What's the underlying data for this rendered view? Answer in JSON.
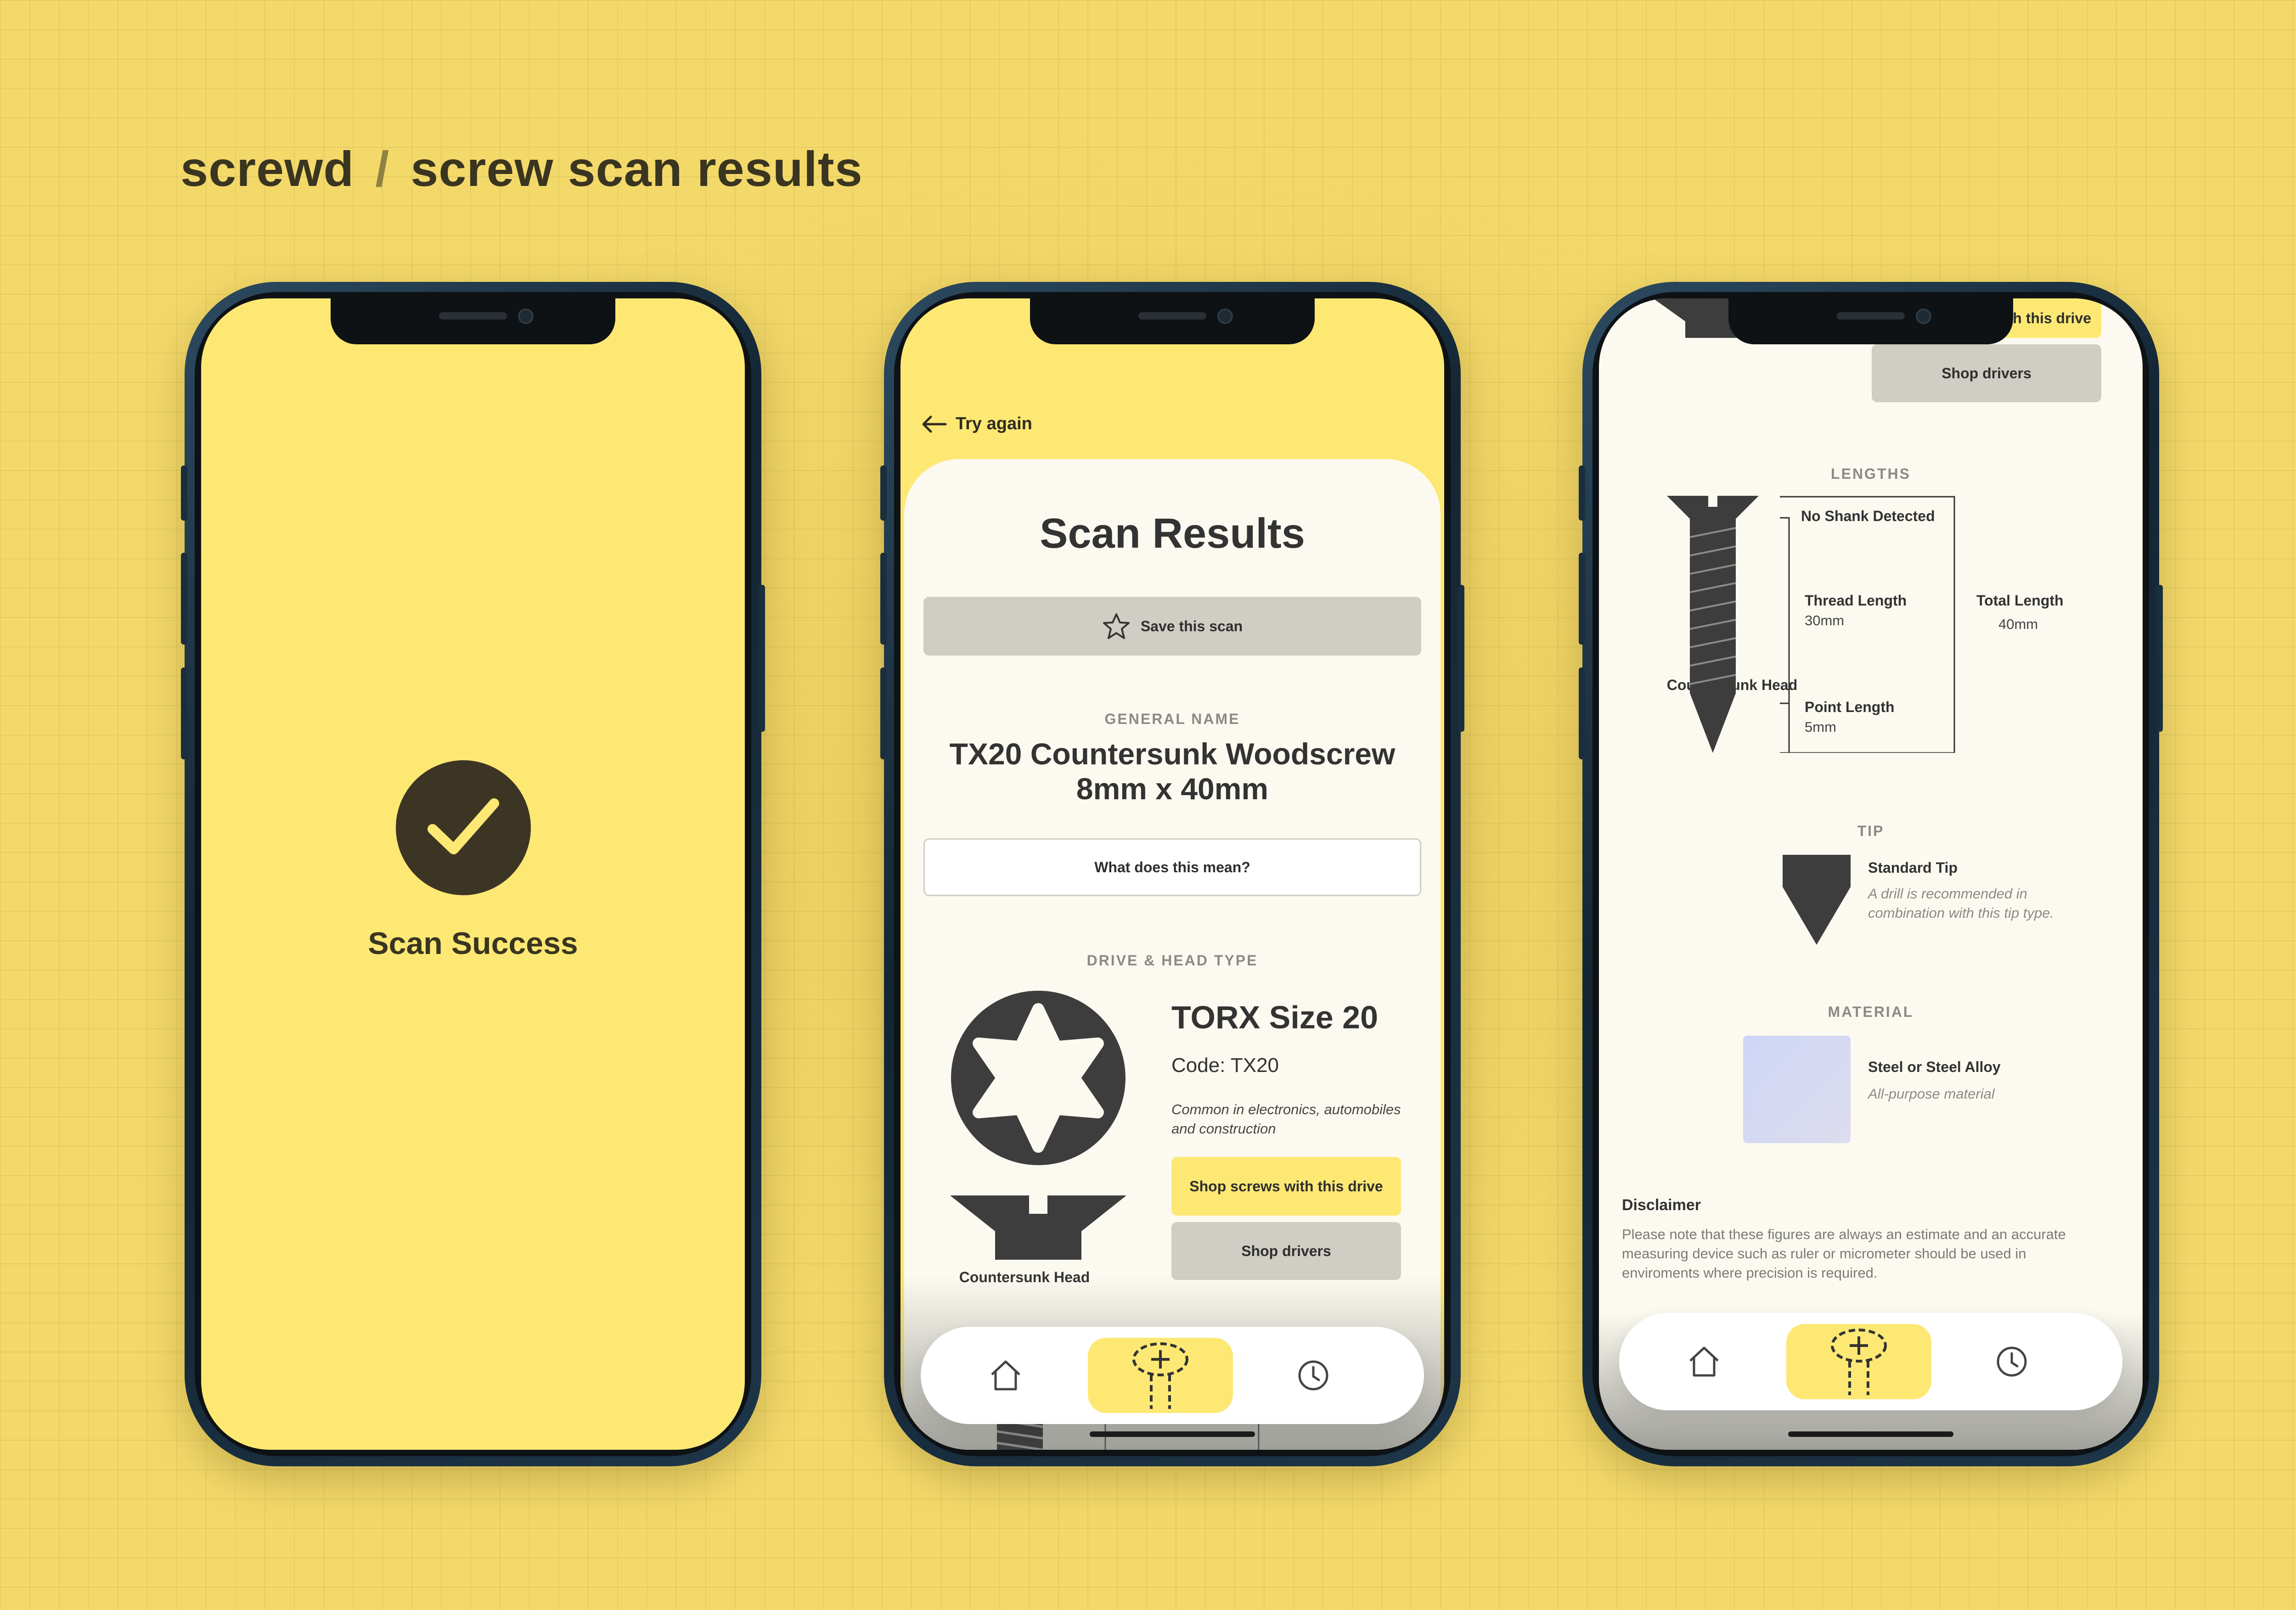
{
  "header": {
    "brand": "screwd",
    "separator": "/",
    "title": "screw scan results"
  },
  "phone1": {
    "status": "Scan Success"
  },
  "phone2": {
    "back_label": "Try again",
    "heading": "Scan Results",
    "save_label": "Save this scan",
    "general_name_label": "GENERAL NAME",
    "general_name": "TX20 Countersunk Woodscrew 8mm x 40mm",
    "what_mean_label": "What does this mean?",
    "drive_head_label": "DRIVE & HEAD TYPE",
    "drive_title": "TORX Size 20",
    "drive_code": "Code: TX20",
    "drive_desc": "Common in electronics, automobiles and construction",
    "shop_screws_label": "Shop screws with this drive",
    "shop_drivers_label": "Shop drivers",
    "head_label": "Countersunk Head"
  },
  "phone3": {
    "top_shop_screws_partial": "th this drive",
    "top_shop_drivers": "Shop drivers",
    "head_label": "Countersunk Head",
    "lengths_label": "LENGTHS",
    "no_shank": "No Shank Detected",
    "thread_length_label": "Thread Length",
    "thread_length_value": "30mm",
    "point_length_label": "Point Length",
    "point_length_value": "5mm",
    "total_length_label": "Total Length",
    "total_length_value": "40mm",
    "tip_label": "TIP",
    "tip_name": "Standard Tip",
    "tip_desc": "A drill is recommended in combination with this tip type.",
    "material_label": "MATERIAL",
    "material_name": "Steel or Steel Alloy",
    "material_desc": "All-purpose material",
    "disclaimer_title": "Disclaimer",
    "disclaimer_text": "Please note that these figures are always an estimate and an accurate measuring device such as ruler or micrometer should be used in enviroments where precision is required."
  },
  "tabbar": {
    "items": [
      {
        "icon": "home-icon"
      },
      {
        "icon": "scan-icon"
      },
      {
        "icon": "history-clock-icon"
      }
    ]
  },
  "colors": {
    "accent_yellow": "#fde874",
    "dark": "#3d3524",
    "card": "#fcfaf0",
    "button_grey": "#cfcdc4"
  }
}
